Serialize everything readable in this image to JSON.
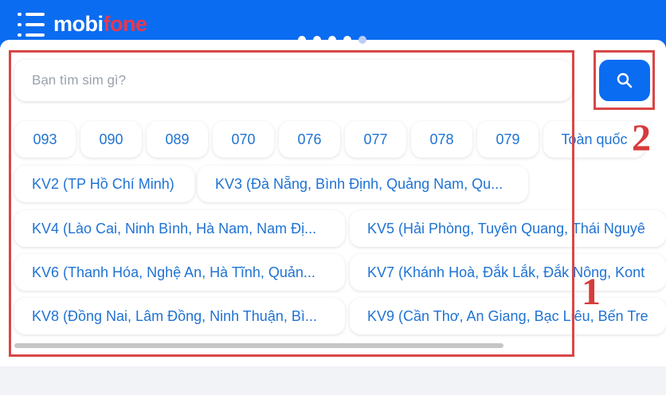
{
  "header": {
    "logo_part1": "mobi",
    "logo_part2": "fone",
    "brand_color": "#0a6cf1",
    "logo_accent_color": "#e8384f"
  },
  "search": {
    "placeholder": "Bạn tìm sim gì?"
  },
  "prefixes": [
    "093",
    "090",
    "089",
    "070",
    "076",
    "077",
    "078",
    "079",
    "Toàn quốc"
  ],
  "regions": [
    "KV2 (TP Hồ Chí Minh)",
    "KV3 (Đà Nẵng, Bình Định, Quảng Nam, Qu...",
    "KV4 (Lào Cai, Ninh Bình, Hà Nam, Nam Đị...",
    "KV5 (Hải Phòng, Tuyên Quang, Thái Nguyê",
    "KV6 (Thanh Hóa, Nghệ An, Hà Tĩnh, Quản...",
    "KV7 (Khánh Hoà, Đắk Lắk, Đắk Nông, Kont",
    "KV8 (Đồng Nai, Lâm Đồng, Ninh Thuận, Bì...",
    "KV9 (Cần Thơ, An Giang, Bạc Liêu, Bến Tre"
  ],
  "annotations": {
    "label_1": "1",
    "label_2": "2",
    "color": "#d94646"
  }
}
